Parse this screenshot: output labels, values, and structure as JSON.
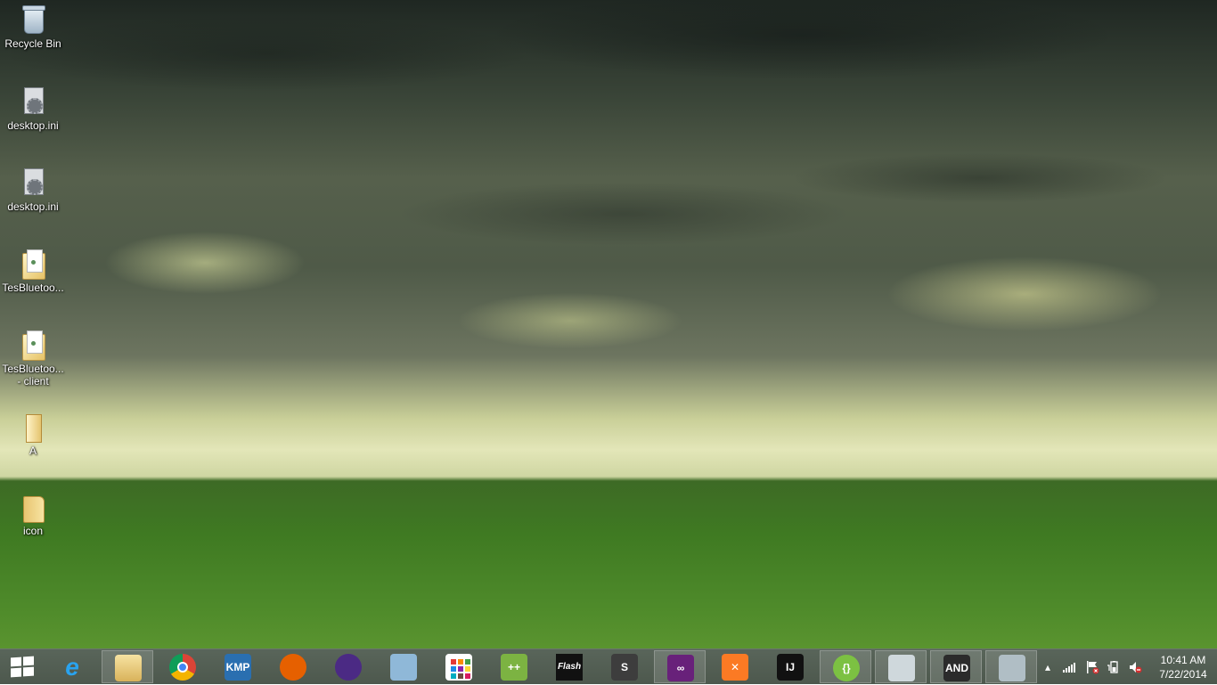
{
  "desktop": {
    "icons": [
      {
        "label": "Recycle Bin",
        "icon": "recycle-bin-icon"
      },
      {
        "label": "desktop.ini",
        "icon": "settings-file-icon"
      },
      {
        "label": "desktop.ini",
        "icon": "settings-file-icon"
      },
      {
        "label": "TesBluetoo...",
        "icon": "folder-document-icon"
      },
      {
        "label": "TesBluetoo...\n- client",
        "icon": "folder-document-icon"
      },
      {
        "label": "A",
        "icon": "open-folder-icon"
      },
      {
        "label": "icon",
        "icon": "folder-icon"
      }
    ]
  },
  "taskbar": {
    "start_icon": "windows-logo-icon",
    "apps": [
      {
        "name": "internet-explorer",
        "icon": "internet-explorer-icon",
        "glyph": "e",
        "color": "#1e88e5"
      },
      {
        "name": "file-explorer",
        "icon": "file-explorer-icon",
        "glyph": "",
        "color": "#e8c570"
      },
      {
        "name": "chrome",
        "icon": "chrome-icon",
        "glyph": "",
        "color": "#db4437"
      },
      {
        "name": "kmplayer",
        "icon": "kmplayer-icon",
        "glyph": "KMP",
        "color": "#2a6fb0"
      },
      {
        "name": "firefox",
        "icon": "firefox-icon",
        "glyph": "",
        "color": "#e66000"
      },
      {
        "name": "eclipse",
        "icon": "eclipse-icon",
        "glyph": "",
        "color": "#4b2a84"
      },
      {
        "name": "virtualbox",
        "icon": "cube-icon",
        "glyph": "",
        "color": "#8fb8d8"
      },
      {
        "name": "app-grid",
        "icon": "app-grid-icon",
        "glyph": "",
        "color": "#ffffff"
      },
      {
        "name": "notepad-plus-plus",
        "icon": "notepad-plus-plus-icon",
        "glyph": "++",
        "color": "#7cb342"
      },
      {
        "name": "flash",
        "icon": "flash-icon",
        "glyph": "Flash",
        "color": "#111111"
      },
      {
        "name": "sublime-text",
        "icon": "sublime-text-icon",
        "glyph": "S",
        "color": "#3d3d3d"
      },
      {
        "name": "visual-studio",
        "icon": "visual-studio-icon",
        "glyph": "∞",
        "color": "#68217a"
      },
      {
        "name": "xampp",
        "icon": "xampp-icon",
        "glyph": "✕",
        "color": "#fb7a24"
      },
      {
        "name": "intellij",
        "icon": "intellij-icon",
        "glyph": "IJ",
        "color": "#111111"
      },
      {
        "name": "brackets",
        "icon": "brackets-icon",
        "glyph": "{}",
        "color": "#7cc142"
      },
      {
        "name": "photo-viewer",
        "icon": "photo-viewer-icon",
        "glyph": "",
        "color": "#cfd8dc"
      },
      {
        "name": "android-studio",
        "icon": "android-icon",
        "glyph": "AND",
        "color": "#2b2b2b"
      },
      {
        "name": "paint",
        "icon": "paint-palette-icon",
        "glyph": "",
        "color": "#b0bec5"
      }
    ],
    "tray": {
      "overflow_icon": "chevron-up-icon",
      "network_icon": "signal-bars-icon",
      "flag_icon": "action-center-flag-icon",
      "battery_icon": "battery-icon",
      "volume_icon": "volume-muted-icon"
    },
    "clock": {
      "time": "10:41 AM",
      "date": "7/22/2014"
    }
  }
}
